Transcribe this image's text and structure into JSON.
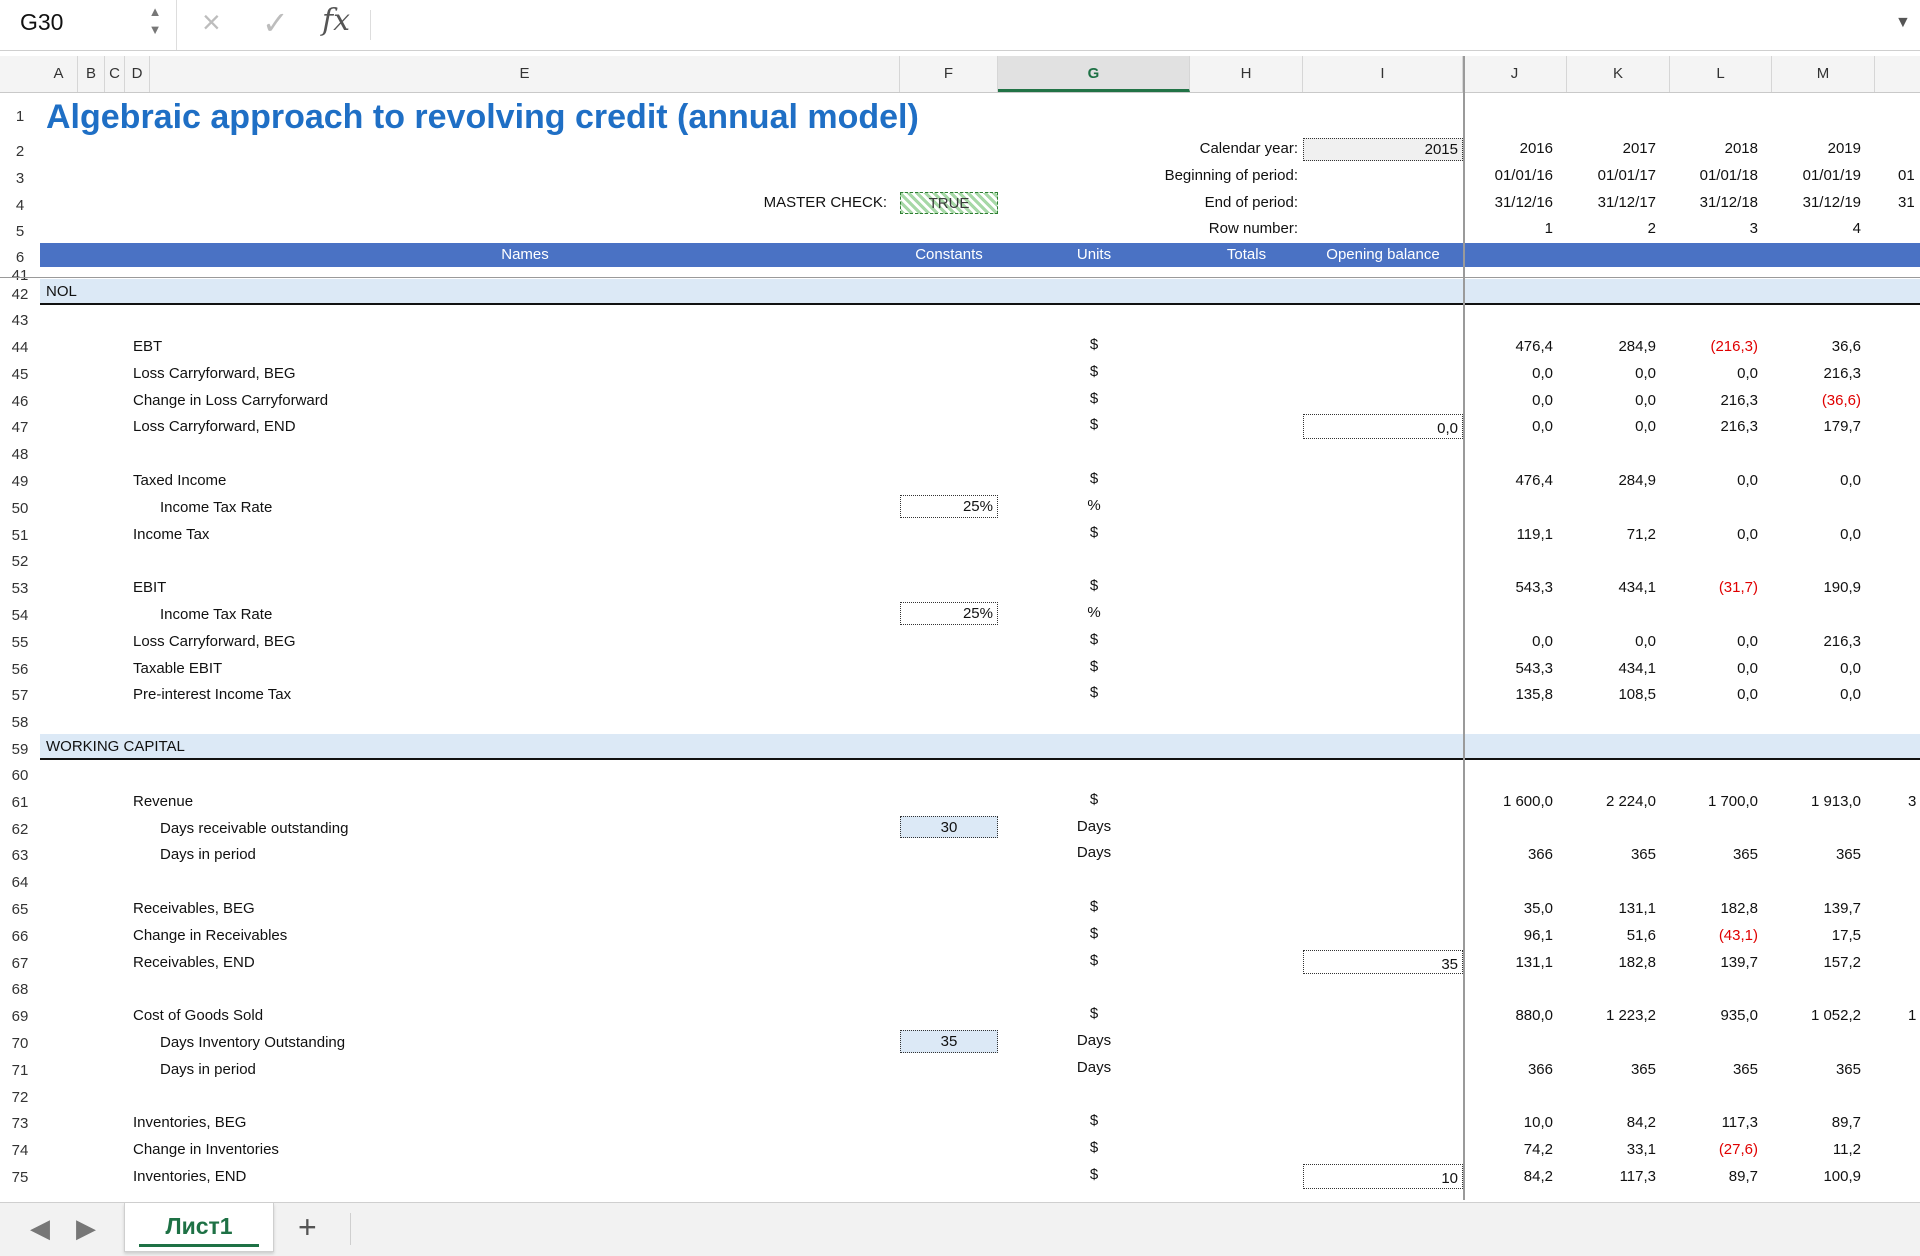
{
  "formula_bar": {
    "cell_ref": "G30",
    "cancel_icon": "×",
    "enter_icon": "✓",
    "fx_label": "fx",
    "formula": ""
  },
  "columns": [
    "A",
    "B",
    "C",
    "D",
    "E",
    "F",
    "G",
    "H",
    "I",
    "J",
    "K",
    "L",
    "M"
  ],
  "selected_column": "G",
  "title": "Algebraic approach to revolving credit (annual model)",
  "header_info": {
    "calendar_year_label": "Calendar year:",
    "calendar_year_value": "2015",
    "beginning_label": "Beginning of period:",
    "end_label": "End of period:",
    "row_number_label": "Row number:",
    "master_check_label": "MASTER CHECK:",
    "master_check_value": "TRUE",
    "years": [
      "2016",
      "2017",
      "2018",
      "2019"
    ],
    "begin_dates": [
      "01/01/16",
      "01/01/17",
      "01/01/18",
      "01/01/19",
      "01"
    ],
    "end_dates": [
      "31/12/16",
      "31/12/17",
      "31/12/18",
      "31/12/19",
      "31"
    ],
    "row_numbers": [
      "1",
      "2",
      "3",
      "4"
    ]
  },
  "table_header": {
    "names": "Names",
    "constants": "Constants",
    "units": "Units",
    "totals": "Totals",
    "opening": "Opening balance"
  },
  "rows": [
    {
      "n": "1"
    },
    {
      "n": "2"
    },
    {
      "n": "3"
    },
    {
      "n": "4"
    },
    {
      "n": "5"
    },
    {
      "n": "6"
    },
    {
      "n": "41"
    },
    {
      "n": "42",
      "section": "NOL"
    },
    {
      "n": "43"
    },
    {
      "n": "44",
      "label": "EBT",
      "unit": "$",
      "vals": [
        "476,4",
        "284,9",
        "(216,3)",
        "36,6"
      ]
    },
    {
      "n": "45",
      "label": "Loss Carryforward, BEG",
      "unit": "$",
      "vals": [
        "0,0",
        "0,0",
        "0,0",
        "216,3"
      ]
    },
    {
      "n": "46",
      "label": "Change in Loss Carryforward",
      "unit": "$",
      "vals": [
        "0,0",
        "0,0",
        "216,3",
        "(36,6)"
      ]
    },
    {
      "n": "47",
      "label": "Loss Carryforward, END",
      "unit": "$",
      "opening": "0,0",
      "vals": [
        "0,0",
        "0,0",
        "216,3",
        "179,7"
      ]
    },
    {
      "n": "48"
    },
    {
      "n": "49",
      "label": "Taxed Income",
      "unit": "$",
      "vals": [
        "476,4",
        "284,9",
        "0,0",
        "0,0"
      ]
    },
    {
      "n": "50",
      "label": "Income Tax Rate",
      "indent": true,
      "const": "25%",
      "unit": "%"
    },
    {
      "n": "51",
      "label": "Income Tax",
      "unit": "$",
      "vals": [
        "119,1",
        "71,2",
        "0,0",
        "0,0"
      ]
    },
    {
      "n": "52"
    },
    {
      "n": "53",
      "label": "EBIT",
      "unit": "$",
      "vals": [
        "543,3",
        "434,1",
        "(31,7)",
        "190,9"
      ]
    },
    {
      "n": "54",
      "label": "Income Tax Rate",
      "indent": true,
      "const": "25%",
      "unit": "%"
    },
    {
      "n": "55",
      "label": "Loss Carryforward, BEG",
      "unit": "$",
      "vals": [
        "0,0",
        "0,0",
        "0,0",
        "216,3"
      ]
    },
    {
      "n": "56",
      "label": "Taxable EBIT",
      "unit": "$",
      "vals": [
        "543,3",
        "434,1",
        "0,0",
        "0,0"
      ]
    },
    {
      "n": "57",
      "label": "Pre-interest Income Tax",
      "unit": "$",
      "vals": [
        "135,8",
        "108,5",
        "0,0",
        "0,0"
      ]
    },
    {
      "n": "58"
    },
    {
      "n": "59",
      "section": "WORKING CAPITAL"
    },
    {
      "n": "60"
    },
    {
      "n": "61",
      "label": "Revenue",
      "unit": "$",
      "vals": [
        "1 600,0",
        "2 224,0",
        "1 700,0",
        "1 913,0"
      ],
      "edge": "3"
    },
    {
      "n": "62",
      "label": "Days receivable outstanding",
      "indent": true,
      "const": "30",
      "constBlue": true,
      "unit": "Days"
    },
    {
      "n": "63",
      "label": "Days in period",
      "indent": true,
      "unit": "Days",
      "vals": [
        "366",
        "365",
        "365",
        "365"
      ]
    },
    {
      "n": "64"
    },
    {
      "n": "65",
      "label": "Receivables, BEG",
      "unit": "$",
      "vals": [
        "35,0",
        "131,1",
        "182,8",
        "139,7"
      ]
    },
    {
      "n": "66",
      "label": "Change in Receivables",
      "unit": "$",
      "vals": [
        "96,1",
        "51,6",
        "(43,1)",
        "17,5"
      ]
    },
    {
      "n": "67",
      "label": "Receivables, END",
      "unit": "$",
      "opening": "35",
      "vals": [
        "131,1",
        "182,8",
        "139,7",
        "157,2"
      ]
    },
    {
      "n": "68"
    },
    {
      "n": "69",
      "label": "Cost of Goods Sold",
      "unit": "$",
      "vals": [
        "880,0",
        "1 223,2",
        "935,0",
        "1 052,2"
      ],
      "edge": "1"
    },
    {
      "n": "70",
      "label": "Days Inventory Outstanding",
      "indent": true,
      "const": "35",
      "constBlue": true,
      "unit": "Days"
    },
    {
      "n": "71",
      "label": "Days in period",
      "indent": true,
      "unit": "Days",
      "vals": [
        "366",
        "365",
        "365",
        "365"
      ]
    },
    {
      "n": "72"
    },
    {
      "n": "73",
      "label": "Inventories, BEG",
      "unit": "$",
      "vals": [
        "10,0",
        "84,2",
        "117,3",
        "89,7"
      ]
    },
    {
      "n": "74",
      "label": "Change in Inventories",
      "unit": "$",
      "vals": [
        "74,2",
        "33,1",
        "(27,6)",
        "11,2"
      ]
    },
    {
      "n": "75",
      "label": "Inventories, END",
      "unit": "$",
      "opening": "10",
      "vals": [
        "84,2",
        "117,3",
        "89,7",
        "100,9"
      ]
    }
  ],
  "sheet_tab": "Лист1",
  "add_sheet_label": "+"
}
